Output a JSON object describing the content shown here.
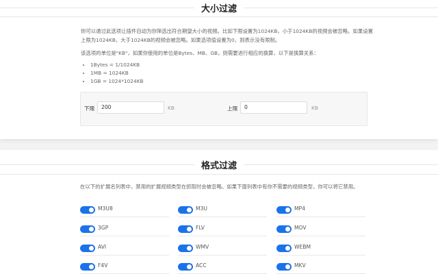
{
  "size_filter": {
    "title": "大小过滤",
    "desc1": "你可以通过此选项让插件自动为你筛选出符合期望大小的视频。比如下限设置为1024KB，小于1024KB的视频会被忽略。如果设置上限为1024KB，大于1024KB的视频会被忽略。如果选项值设置为0，则表示没有限制。",
    "desc2": "该选项的单位是\"KB\"，如果你使用的单位是Bytes、MB、GB，则需要进行相应的换算，以下是换算关系：",
    "conversions": [
      "1Bytes = 1/1024KB",
      "1MB = 1024KB",
      "1GB = 1024*1024KB"
    ],
    "lower_label": "下限",
    "lower_value": "200",
    "upper_label": "上限",
    "upper_value": "0",
    "unit": "KB"
  },
  "format_filter": {
    "title": "格式过滤",
    "desc": "在以下的扩展名列表中，禁用的扩展视频类型在抓取时会被忽略。如果下面列表中有你不需要的视频类型，你可以将它禁用。",
    "formats": [
      {
        "name": "M3U8",
        "enabled": true
      },
      {
        "name": "M3U",
        "enabled": true
      },
      {
        "name": "MP4",
        "enabled": true
      },
      {
        "name": "3GP",
        "enabled": true
      },
      {
        "name": "FLV",
        "enabled": true
      },
      {
        "name": "MOV",
        "enabled": true
      },
      {
        "name": "AVI",
        "enabled": true
      },
      {
        "name": "WMV",
        "enabled": true
      },
      {
        "name": "WEBM",
        "enabled": true
      },
      {
        "name": "F4V",
        "enabled": true
      },
      {
        "name": "ACC",
        "enabled": true
      },
      {
        "name": "MKV",
        "enabled": true
      }
    ]
  },
  "colors": {
    "accent": "#1a73e8"
  }
}
